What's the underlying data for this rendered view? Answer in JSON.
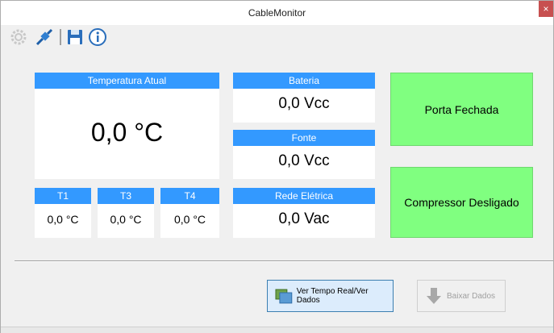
{
  "window": {
    "title": "CableMonitor",
    "close_label": "×"
  },
  "toolbar": {
    "icons": [
      "gear-icon",
      "connect-icon",
      "save-icon",
      "info-icon"
    ]
  },
  "temperature": {
    "header": "Temperatura Atual",
    "value": "0,0 °C",
    "sensors": [
      {
        "label": "T1",
        "value": "0,0 °C"
      },
      {
        "label": "T3",
        "value": "0,0 °C"
      },
      {
        "label": "T4",
        "value": "0,0 °C"
      }
    ]
  },
  "power": {
    "bateria": {
      "header": "Bateria",
      "value": "0,0 Vcc"
    },
    "fonte": {
      "header": "Fonte",
      "value": "0,0 Vcc"
    },
    "rede": {
      "header": "Rede Elétrica",
      "value": "0,0 Vac"
    }
  },
  "status": {
    "porta": "Porta Fechada",
    "compressor": "Compressor Desligado",
    "color": "#80ff80"
  },
  "actions": {
    "realtime_label": "Ver Tempo Real/Ver Dados",
    "download_label": "Baixar Dados"
  },
  "colors": {
    "header": "#3399ff"
  }
}
